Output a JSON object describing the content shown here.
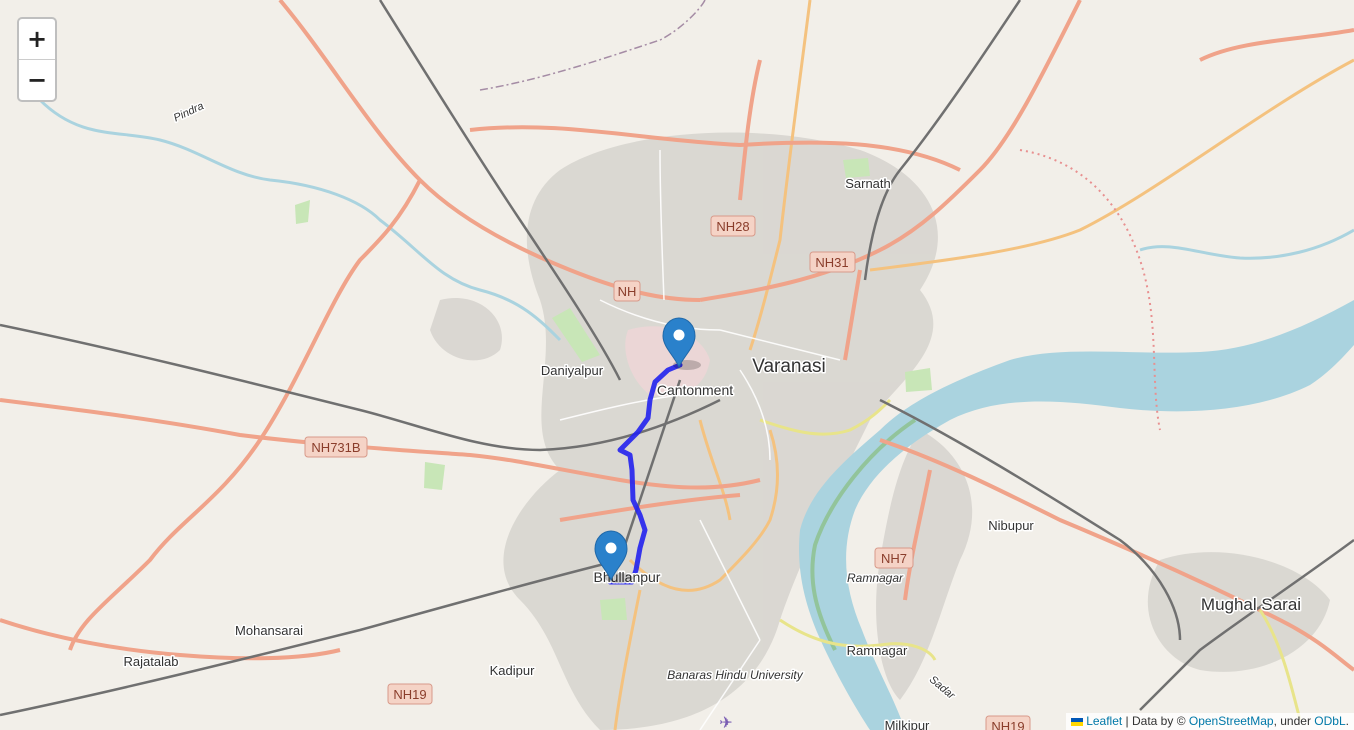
{
  "map": {
    "place_labels": {
      "varanasi": "Varanasi",
      "cantonment": "Cantonment",
      "daniyalpur": "Daniyalpur",
      "sarnath": "Sarnath",
      "bhullanpur": "Bhullanpur",
      "mohansarai": "Mohansarai",
      "rajatalab": "Rajatalab",
      "kadipur": "Kadipur",
      "banaras_hindu_university": "Banaras Hindu University",
      "ramnagar": "Ramnagar",
      "ramnagar_italic": "Ramnagar",
      "nibupur": "Nibupur",
      "mughal_sarai": "Mughal Sarai",
      "milkipur": "Milkipur",
      "pindra": "Pindra",
      "sadar": "Sadar"
    },
    "road_shields": {
      "nh28": "NH28",
      "nh31": "NH31",
      "nh": "NH",
      "nh731b": "NH731B",
      "nh7": "NH7",
      "nh19_left": "NH19",
      "nh19_right": "NH19"
    },
    "markers": [
      {
        "name": "Cantonment marker",
        "icon": "map-pin-icon",
        "color": "#2a81cb"
      },
      {
        "name": "Bhullanpur marker",
        "icon": "map-pin-icon",
        "color": "#2a81cb"
      }
    ],
    "route": {
      "color": "#2222ee"
    }
  },
  "controls": {
    "zoom_in": "+",
    "zoom_out": "−"
  },
  "attribution": {
    "leaflet": "Leaflet",
    "separator": " | Data by © ",
    "osm": "OpenStreetMap",
    "under": ", under ",
    "odbl": "ODbL",
    "end": "."
  },
  "colors": {
    "land": "#f2efe9",
    "urban": "#d9d5d0",
    "water": "#aad3df",
    "primary_road": "#f0a38a",
    "secondary_road": "#f7cf8f",
    "railway": "#7b7b7b",
    "route": "#2222ee",
    "marker": "#2a81cb"
  }
}
